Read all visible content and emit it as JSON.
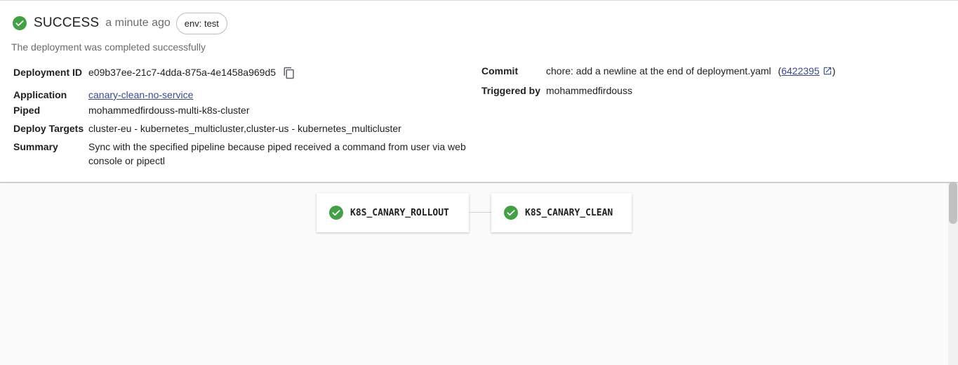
{
  "header": {
    "status": "SUCCESS",
    "time_ago": "a minute ago",
    "env_chip": "env: test",
    "description": "The deployment was completed successfully"
  },
  "details": {
    "deployment_id_label": "Deployment ID",
    "deployment_id": "e09b37ee-21c7-4dda-875a-4e1458a969d5",
    "application_label": "Application",
    "application": "canary-clean-no-service",
    "piped_label": "Piped",
    "piped": "mohammedfirdouss-multi-k8s-cluster",
    "deploy_targets_label": "Deploy Targets",
    "deploy_targets": "cluster-eu - kubernetes_multicluster,cluster-us - kubernetes_multicluster",
    "summary_label": "Summary",
    "summary_line1": "Sync with the specified pipeline because piped received a command from user via web",
    "summary_line2": "console or pipectl",
    "commit_label": "Commit",
    "commit_message": "chore: add a newline at the end of deployment.yaml",
    "commit_open_paren": "(",
    "commit_hash": "6422395",
    "commit_close_paren": ")",
    "triggered_by_label": "Triggered by",
    "triggered_by": "mohammedfirdouss"
  },
  "pipeline": {
    "stages": [
      {
        "name": "K8S_CANARY_ROLLOUT",
        "status": "success"
      },
      {
        "name": "K8S_CANARY_CLEAN",
        "status": "success"
      }
    ]
  },
  "icons": {
    "status": "check-circle-icon",
    "copy": "copy-icon",
    "external_link": "open-in-new-icon"
  },
  "colors": {
    "success": "#43a047",
    "link": "#3a4a8a"
  }
}
